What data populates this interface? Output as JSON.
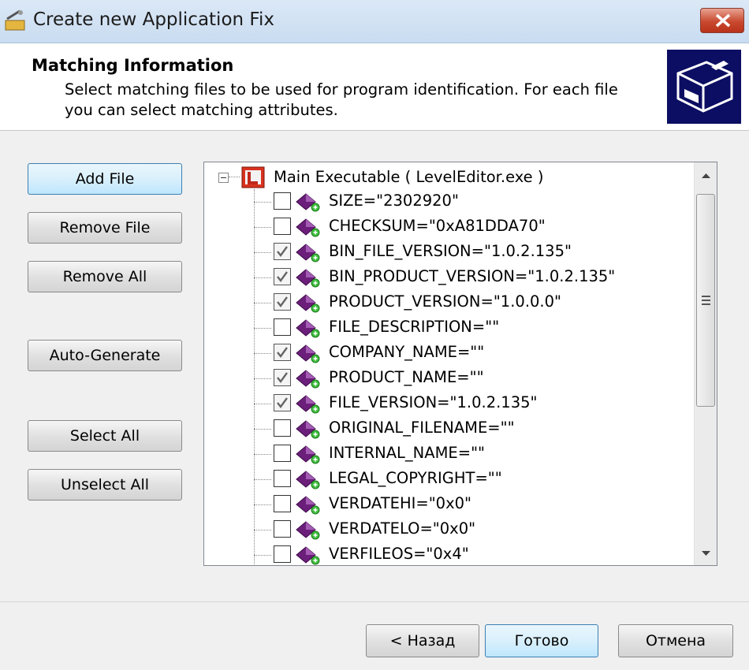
{
  "window": {
    "title": "Create new Application Fix"
  },
  "header": {
    "title": "Matching Information",
    "description": "Select matching files to be used for program identification. For each file you can select matching attributes."
  },
  "left_buttons": {
    "add_file": "Add File",
    "remove_file": "Remove File",
    "remove_all": "Remove All",
    "auto_generate": "Auto-Generate",
    "select_all": "Select All",
    "unselect_all": "Unselect All"
  },
  "tree": {
    "root_label": "Main Executable ( LevelEditor.exe )",
    "items": [
      {
        "label": "SIZE=\"2302920\"",
        "checked": false
      },
      {
        "label": "CHECKSUM=\"0xA81DDA70\"",
        "checked": false
      },
      {
        "label": "BIN_FILE_VERSION=\"1.0.2.135\"",
        "checked": true
      },
      {
        "label": "BIN_PRODUCT_VERSION=\"1.0.2.135\"",
        "checked": true
      },
      {
        "label": "PRODUCT_VERSION=\"1.0.0.0\"",
        "checked": true
      },
      {
        "label": "FILE_DESCRIPTION=\"\"",
        "checked": false
      },
      {
        "label": "COMPANY_NAME=\"\"",
        "checked": true
      },
      {
        "label": "PRODUCT_NAME=\"\"",
        "checked": true
      },
      {
        "label": "FILE_VERSION=\"1.0.2.135\"",
        "checked": true
      },
      {
        "label": "ORIGINAL_FILENAME=\"\"",
        "checked": false
      },
      {
        "label": "INTERNAL_NAME=\"\"",
        "checked": false
      },
      {
        "label": "LEGAL_COPYRIGHT=\"\"",
        "checked": false
      },
      {
        "label": "VERDATEHI=\"0x0\"",
        "checked": false
      },
      {
        "label": "VERDATELO=\"0x0\"",
        "checked": false
      },
      {
        "label": "VERFILEOS=\"0x4\"",
        "checked": false
      }
    ]
  },
  "footer": {
    "back": "< Назад",
    "finish": "Готово",
    "cancel": "Отмена"
  },
  "colors": {
    "close_button": "#c9492f",
    "focused_button": "#bee6fd",
    "attribute_icon": "#6b1f7a",
    "exe_icon": "#c0281a",
    "logo_background": "#0c0e63"
  }
}
